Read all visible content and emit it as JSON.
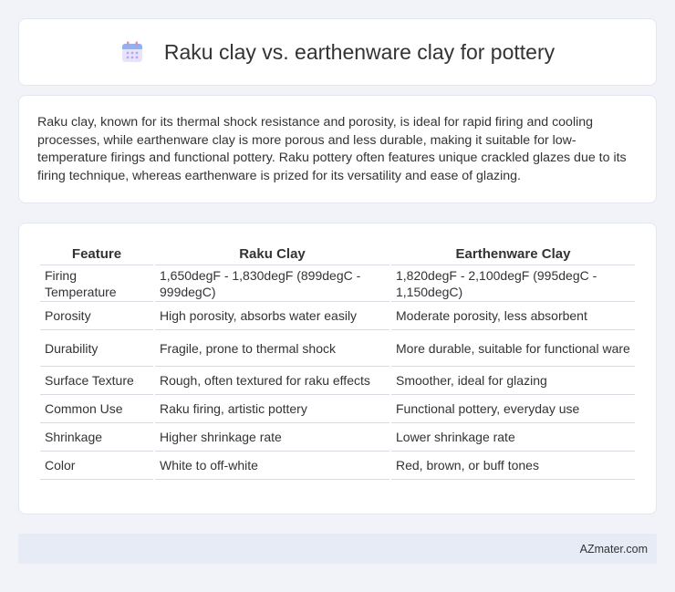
{
  "header": {
    "title": "Raku clay vs. earthenware clay for pottery",
    "icon": "calendar-icon"
  },
  "description": "Raku clay, known for its thermal shock resistance and porosity, is ideal for rapid firing and cooling processes, while earthenware clay is more porous and less durable, making it suitable for low-temperature firings and functional pottery. Raku pottery often features unique crackled glazes due to its firing technique, whereas earthenware is prized for its versatility and ease of glazing.",
  "table": {
    "headers": [
      "Feature",
      "Raku Clay",
      "Earthenware Clay"
    ],
    "rows": [
      [
        "Firing Temperature",
        "1,650degF - 1,830degF (899degC - 999degC)",
        "1,820degF - 2,100degF (995degC - 1,150degC)"
      ],
      [
        "Porosity",
        "High porosity, absorbs water easily",
        "Moderate porosity, less absorbent"
      ],
      [
        "Durability",
        "Fragile, prone to thermal shock",
        "More durable, suitable for functional ware"
      ],
      [
        "Surface Texture",
        "Rough, often textured for raku effects",
        "Smoother, ideal for glazing"
      ],
      [
        "Common Use",
        "Raku firing, artistic pottery",
        "Functional pottery, everyday use"
      ],
      [
        "Shrinkage",
        "Higher shrinkage rate",
        "Lower shrinkage rate"
      ],
      [
        "Color",
        "White to off-white",
        "Red, brown, or buff tones"
      ]
    ]
  },
  "footer": {
    "brand": "AZmater.com"
  }
}
